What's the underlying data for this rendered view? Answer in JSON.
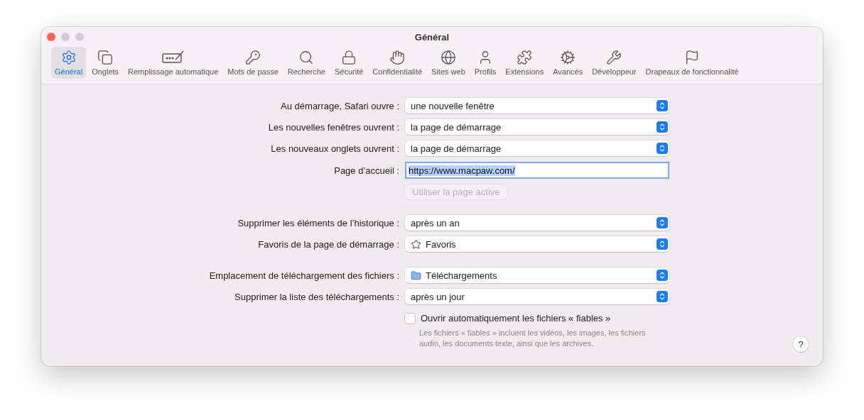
{
  "window": {
    "title": "Général"
  },
  "tabs": [
    {
      "label": "Général",
      "selected": true
    },
    {
      "label": "Onglets",
      "selected": false
    },
    {
      "label": "Remplissage automatique",
      "selected": false
    },
    {
      "label": "Mots de passe",
      "selected": false
    },
    {
      "label": "Recherche",
      "selected": false
    },
    {
      "label": "Sécurité",
      "selected": false
    },
    {
      "label": "Confidentialité",
      "selected": false
    },
    {
      "label": "Sites web",
      "selected": false
    },
    {
      "label": "Profils",
      "selected": false
    },
    {
      "label": "Extensions",
      "selected": false
    },
    {
      "label": "Avancés",
      "selected": false
    },
    {
      "label": "Développeur",
      "selected": false
    },
    {
      "label": "Drapeaux de fonctionnalité",
      "selected": false
    }
  ],
  "groups": [
    {
      "rows": [
        {
          "kind": "select",
          "label": "Au démarrage, Safari ouvre :",
          "value": "une nouvelle fenêtre"
        },
        {
          "kind": "select",
          "label": "Les nouvelles fenêtres ouvrent :",
          "value": "la page de démarrage"
        },
        {
          "kind": "select",
          "label": "Les nouveaux onglets ouvrent :",
          "value": "la page de démarrage"
        },
        {
          "kind": "field",
          "label": "Page d’accueil :",
          "value": "https://www.macpaw.com/",
          "focused": true
        },
        {
          "kind": "button",
          "value": "Utiliser la page active",
          "disabled": true
        }
      ]
    },
    {
      "rows": [
        {
          "kind": "select",
          "label": "Supprimer les éléments de l’historique :",
          "value": "après un an"
        },
        {
          "kind": "select",
          "label": "Favoris de la page de démarrage :",
          "value": "Favoris"
        }
      ]
    },
    {
      "rows": [
        {
          "kind": "select",
          "label": "Emplacement de téléchargement des fichiers :",
          "value": "Téléchargements"
        },
        {
          "kind": "select",
          "label": "Supprimer la liste des téléchargements :",
          "value": "après un jour"
        },
        {
          "kind": "checkbox",
          "value": "Ouvrir automatiquement les fichiers « fiables »",
          "checked": false,
          "note": "Les fichiers « fiables » incluent les vidéos, les images, les fichiers audio, les documents texte, ainsi que les archives."
        }
      ]
    }
  ],
  "help": "?"
}
